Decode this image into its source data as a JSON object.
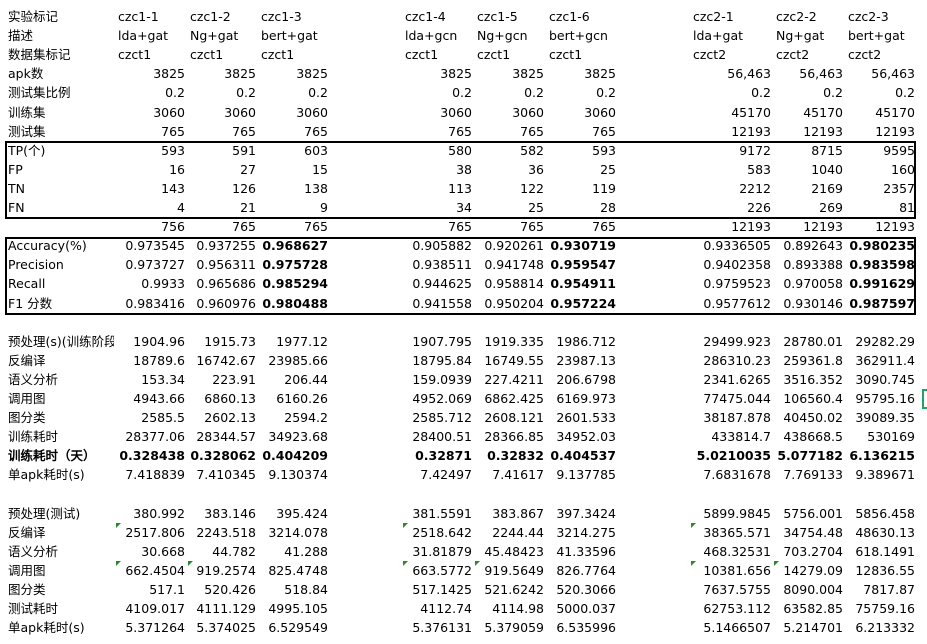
{
  "rows": [
    {
      "label": "实验标记",
      "type": "text",
      "values": [
        "czc1-1",
        "czc1-2",
        "czc1-3",
        "czc1-4",
        "czc1-5",
        "czc1-6",
        "czc2-1",
        "czc2-2",
        "czc2-3"
      ]
    },
    {
      "label": "描述",
      "type": "text",
      "values": [
        "lda+gat",
        "Ng+gat",
        "bert+gat",
        "lda+gcn",
        "Ng+gcn",
        "bert+gcn",
        "lda+gat",
        "Ng+gat",
        "bert+gat"
      ]
    },
    {
      "label": "数据集标记",
      "type": "text",
      "values": [
        "czct1",
        "czct1",
        "czct1",
        "czct1",
        "czct1",
        "czct1",
        "czct2",
        "czct2",
        "czct2"
      ]
    },
    {
      "label": "apk数",
      "values": [
        "3825",
        "3825",
        "3825",
        "3825",
        "3825",
        "3825",
        "56,463",
        "56,463",
        "56,463"
      ]
    },
    {
      "label": "测试集比例",
      "values": [
        "0.2",
        "0.2",
        "0.2",
        "0.2",
        "0.2",
        "0.2",
        "0.2",
        "0.2",
        "0.2"
      ]
    },
    {
      "label": "训练集",
      "values": [
        "3060",
        "3060",
        "3060",
        "3060",
        "3060",
        "3060",
        "45170",
        "45170",
        "45170"
      ]
    },
    {
      "label": "测试集",
      "values": [
        "765",
        "765",
        "765",
        "765",
        "765",
        "765",
        "12193",
        "12193",
        "12193"
      ]
    },
    {
      "label": "TP(个)",
      "values": [
        "593",
        "591",
        "603",
        "580",
        "582",
        "593",
        "9172",
        "8715",
        "9595"
      ]
    },
    {
      "label": "FP",
      "values": [
        "16",
        "27",
        "15",
        "38",
        "36",
        "25",
        "583",
        "1040",
        "160"
      ]
    },
    {
      "label": "TN",
      "values": [
        "143",
        "126",
        "138",
        "113",
        "122",
        "119",
        "2212",
        "2169",
        "2357"
      ]
    },
    {
      "label": "FN",
      "values": [
        "4",
        "21",
        "9",
        "34",
        "25",
        "28",
        "226",
        "269",
        "81"
      ]
    },
    {
      "label": "",
      "values": [
        "756",
        "765",
        "765",
        "765",
        "765",
        "765",
        "12193",
        "12193",
        "12193"
      ]
    },
    {
      "label": "Accuracy(%)",
      "bold_cols": [
        2,
        5,
        8
      ],
      "values": [
        "0.973545",
        "0.937255",
        "0.968627",
        "0.905882",
        "0.920261",
        "0.930719",
        "0.9336505",
        "0.892643",
        "0.980235"
      ]
    },
    {
      "label": "Precision",
      "bold_cols": [
        2,
        5,
        8
      ],
      "values": [
        "0.973727",
        "0.956311",
        "0.975728",
        "0.938511",
        "0.941748",
        "0.959547",
        "0.9402358",
        "0.893388",
        "0.983598"
      ]
    },
    {
      "label": "Recall",
      "bold_cols": [
        2,
        5,
        8
      ],
      "values": [
        "0.9933",
        "0.965686",
        "0.985294",
        "0.944625",
        "0.958814",
        "0.954911",
        "0.9759523",
        "0.970058",
        "0.991629"
      ]
    },
    {
      "label": "F1 分数",
      "bold_cols": [
        2,
        5,
        8
      ],
      "values": [
        "0.983416",
        "0.960976",
        "0.980488",
        "0.941558",
        "0.950204",
        "0.957224",
        "0.9577612",
        "0.930146",
        "0.987597"
      ]
    },
    {
      "label": "",
      "values": [
        "",
        "",
        "",
        "",
        "",
        "",
        "",
        "",
        ""
      ]
    },
    {
      "label": "预处理(s)(训练阶段)",
      "values": [
        "1904.96",
        "1915.73",
        "1977.12",
        "1907.795",
        "1919.335",
        "1986.712",
        "29499.923",
        "28780.01",
        "29282.29"
      ]
    },
    {
      "label": "反编译",
      "values": [
        "18789.6",
        "16742.67",
        "23985.66",
        "18795.84",
        "16749.55",
        "23987.13",
        "286310.23",
        "259361.8",
        "362911.4"
      ]
    },
    {
      "label": "语义分析",
      "values": [
        "153.34",
        "223.91",
        "206.44",
        "159.0939",
        "227.4211",
        "206.6798",
        "2341.6265",
        "3516.352",
        "3090.745"
      ]
    },
    {
      "label": "调用图",
      "values": [
        "4943.66",
        "6860.13",
        "6160.26",
        "4952.069",
        "6862.425",
        "6169.973",
        "77475.044",
        "106560.4",
        "95795.16"
      ]
    },
    {
      "label": "图分类",
      "values": [
        "2585.5",
        "2602.13",
        "2594.2",
        "2585.712",
        "2608.121",
        "2601.533",
        "38187.878",
        "40450.02",
        "39089.35"
      ]
    },
    {
      "label": "训练耗时",
      "values": [
        "28377.06",
        "28344.57",
        "34923.68",
        "28400.51",
        "28366.85",
        "34952.03",
        "433814.7",
        "438668.5",
        "530169"
      ]
    },
    {
      "label": "训练耗时（天）",
      "bold_label": true,
      "bold_cols": [
        0,
        1,
        2,
        3,
        4,
        5,
        6,
        7,
        8
      ],
      "values": [
        "0.328438",
        "0.328062",
        "0.404209",
        "0.32871",
        "0.32832",
        "0.404537",
        "5.0210035",
        "5.077182",
        "6.136215"
      ]
    },
    {
      "label": "单apk耗时(s)",
      "values": [
        "7.418839",
        "7.410345",
        "9.130374",
        "7.42497",
        "7.41617",
        "9.137785",
        "7.6831678",
        "7.769133",
        "9.389671"
      ]
    },
    {
      "label": "",
      "values": [
        "",
        "",
        "",
        "",
        "",
        "",
        "",
        "",
        ""
      ]
    },
    {
      "label": "预处理(测试)",
      "values": [
        "380.992",
        "383.146",
        "395.424",
        "381.5591",
        "383.867",
        "397.3424",
        "5899.9845",
        "5756.001",
        "5856.458"
      ]
    },
    {
      "label": "反编译",
      "ticks": [
        0,
        3,
        6
      ],
      "values": [
        "2517.806",
        "2243.518",
        "3214.078",
        "2518.642",
        "2244.44",
        "3214.275",
        "38365.571",
        "34754.48",
        "48630.13"
      ]
    },
    {
      "label": "语义分析",
      "values": [
        "30.668",
        "44.782",
        "41.288",
        "31.81879",
        "45.48423",
        "41.33596",
        "468.32531",
        "703.2704",
        "618.1491"
      ]
    },
    {
      "label": "调用图",
      "ticks": [
        0,
        1,
        3,
        4,
        6,
        7
      ],
      "values": [
        "662.4504",
        "919.2574",
        "825.4748",
        "663.5772",
        "919.5649",
        "826.7764",
        "10381.656",
        "14279.09",
        "12836.55"
      ]
    },
    {
      "label": "图分类",
      "values": [
        "517.1",
        "520.426",
        "518.84",
        "517.1425",
        "521.6242",
        "520.3066",
        "7637.5755",
        "8090.004",
        "7817.87"
      ]
    },
    {
      "label": "测试耗时",
      "values": [
        "4109.017",
        "4111.129",
        "4995.105",
        "4112.74",
        "4114.98",
        "5000.037",
        "62753.112",
        "63582.85",
        "75759.16"
      ]
    },
    {
      "label": "单apk耗时(s)",
      "values": [
        "5.371264",
        "5.374025",
        "6.529549",
        "5.376131",
        "5.379059",
        "6.535996",
        "5.1466507",
        "5.214701",
        "6.213332"
      ]
    }
  ],
  "row_numbers": [
    "",
    "",
    "",
    "",
    "",
    "",
    "",
    "",
    "",
    "",
    "",
    "",
    "",
    "",
    "",
    "",
    "",
    "",
    "",
    "",
    "",
    "",
    "",
    "",
    "",
    "",
    "",
    "",
    "",
    "",
    "",
    "",
    ""
  ],
  "colors": {
    "tick": "#2a8a2a",
    "selection": "#21a366",
    "box_border": "#000000"
  }
}
